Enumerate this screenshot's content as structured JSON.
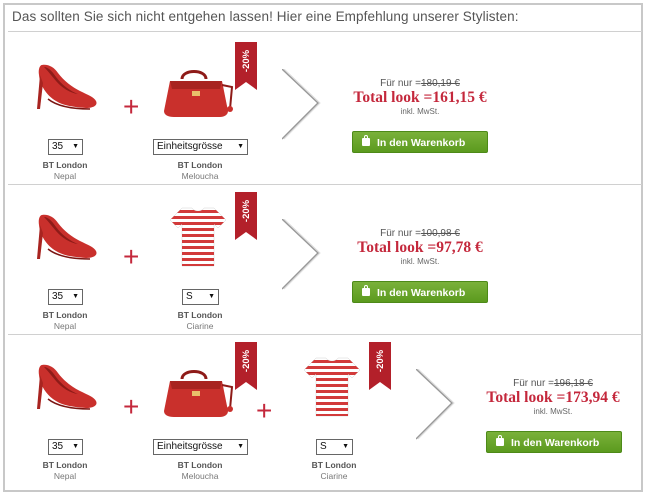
{
  "heading": "Das sollten Sie sich nicht entgehen lassen!   Hier eine Empfehlung unserer Stylisten:",
  "discount_badge": "-20%",
  "plus_sign": "+",
  "colors": {
    "accent": "#c4283c",
    "button": "#6aa62b"
  },
  "bundles": [
    {
      "items": [
        {
          "kind": "shoe",
          "size": "35",
          "brand": "BT London",
          "model": "Nepal"
        },
        {
          "kind": "bag",
          "size": "Einheitsgrösse",
          "brand": "BT London",
          "model": "Meloucha"
        }
      ],
      "for_only": "Für nur =",
      "old_price": "180,19 €",
      "total_label": "Total look =",
      "total": "161,15 €",
      "vat": "inkl. MwSt.",
      "cart_button": "In den Warenkorb"
    },
    {
      "items": [
        {
          "kind": "shoe",
          "size": "35",
          "brand": "BT London",
          "model": "Nepal"
        },
        {
          "kind": "shirt",
          "size": "S",
          "brand": "BT London",
          "model": "Ciarine"
        }
      ],
      "for_only": "Für nur =",
      "old_price": "100,98 €",
      "total_label": "Total look =",
      "total": "97,78 €",
      "vat": "inkl. MwSt.",
      "cart_button": "In den Warenkorb"
    },
    {
      "items": [
        {
          "kind": "shoe",
          "size": "35",
          "brand": "BT London",
          "model": "Nepal"
        },
        {
          "kind": "bag",
          "size": "Einheitsgrösse",
          "brand": "BT London",
          "model": "Meloucha"
        },
        {
          "kind": "shirt",
          "size": "S",
          "brand": "BT London",
          "model": "Ciarine"
        }
      ],
      "for_only": "Für nur =",
      "old_price": "196,18 €",
      "total_label": "Total look =",
      "total": "173,94 €",
      "vat": "inkl. MwSt.",
      "cart_button": "In den Warenkorb"
    }
  ]
}
